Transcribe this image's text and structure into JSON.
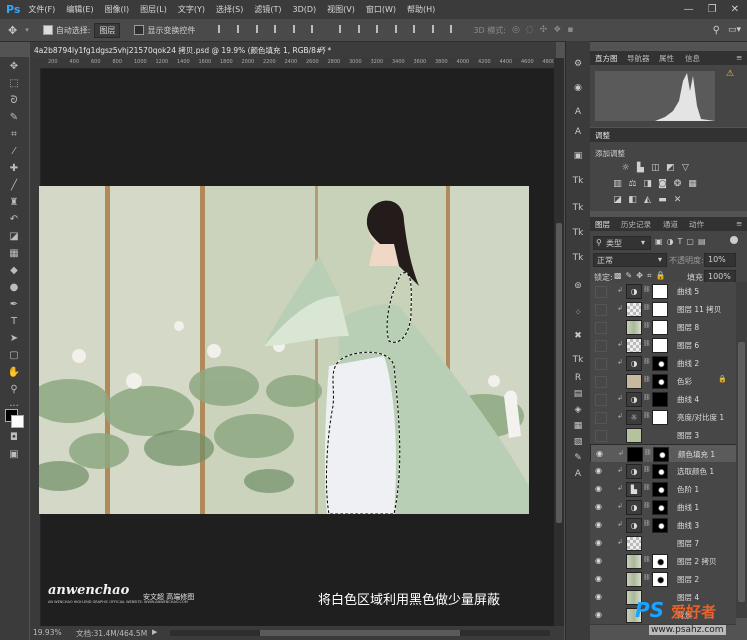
{
  "app": {
    "logo": "Ps"
  },
  "menu": [
    "文件(F)",
    "编辑(E)",
    "图像(I)",
    "图层(L)",
    "文字(Y)",
    "选择(S)",
    "滤镜(T)",
    "3D(D)",
    "视图(V)",
    "窗口(W)",
    "帮助(H)"
  ],
  "window_controls": [
    "—",
    "❐",
    "✕"
  ],
  "options": {
    "auto_select_label": "自动选择:",
    "auto_select_value": "图层",
    "show_transform_label": "显示变换控件",
    "mode_3d_label": "3D 模式:"
  },
  "document": {
    "tab_title": "4a2b8794ly1fg1dgsz5vhj21570qok24 拷贝.psd @ 19.9% (颜色填充 1, RGB/8#) *",
    "zoom": "19.93%",
    "doc_size": "文档:31.4M/464.5M",
    "ruler_marks": [
      "200",
      "400",
      "600",
      "800",
      "1000",
      "1200",
      "1400",
      "1600",
      "1800",
      "2000",
      "2200",
      "2400",
      "2600",
      "2800",
      "3000",
      "3200",
      "3400",
      "3600",
      "3800",
      "4000",
      "4200",
      "4400",
      "4600",
      "4800"
    ]
  },
  "watermark": {
    "brand": "anwenchao",
    "cn_brand": "安文超 高端修图",
    "tagline": "AN WENCHAO HIGH-END GRAPHIC OFFICIAL WEBSITE: WWW.ANWENCHAO.COM"
  },
  "caption": "将白色区域利用黑色做少量屏蔽",
  "panels": {
    "histogram_tabs": [
      "直方图",
      "导航器",
      "属性",
      "信息"
    ],
    "adjustments_tab": "调整",
    "adjustments_subtitle": "添加调整",
    "layers_tabs": [
      "图层",
      "历史记录",
      "通道",
      "动作"
    ],
    "filter_kind": "类型",
    "blend_mode": "正常",
    "opacity_label": "不透明度:",
    "opacity_value": "10%",
    "lock_label": "锁定:",
    "fill_label": "填充:",
    "fill_value": "100%"
  },
  "layers": [
    {
      "name": "曲线 5",
      "visible": false,
      "clipped": true,
      "thumb": "curves",
      "mask": "white"
    },
    {
      "name": "图层 11 拷贝",
      "visible": false,
      "clipped": true,
      "thumb": "checker",
      "mask": "white"
    },
    {
      "name": "图层 8",
      "visible": false,
      "clipped": false,
      "thumb": "photo",
      "mask": "white"
    },
    {
      "name": "图层 6",
      "visible": false,
      "clipped": true,
      "thumb": "checker",
      "mask": "white"
    },
    {
      "name": "曲线 2",
      "visible": false,
      "clipped": true,
      "thumb": "curves",
      "mask": "black-figure"
    },
    {
      "name": "色彩",
      "visible": false,
      "clipped": false,
      "thumb": "tan",
      "mask": "black-figure",
      "locked": true
    },
    {
      "name": "曲线 4",
      "visible": false,
      "clipped": true,
      "thumb": "curves",
      "mask": "black"
    },
    {
      "name": "亮度/对比度 1",
      "visible": false,
      "clipped": true,
      "thumb": "brightness",
      "mask": "white"
    },
    {
      "name": "图层 3",
      "visible": false,
      "clipped": false,
      "thumb": "green",
      "mask": ""
    },
    {
      "name": "颜色填充 1",
      "visible": true,
      "clipped": true,
      "thumb": "black-fill",
      "mask": "black-figure",
      "selected": true
    },
    {
      "name": "选取颜色 1",
      "visible": true,
      "clipped": true,
      "thumb": "selective",
      "mask": "black-figure"
    },
    {
      "name": "色阶 1",
      "visible": true,
      "clipped": true,
      "thumb": "levels",
      "mask": "black-figure"
    },
    {
      "name": "曲线 1",
      "visible": true,
      "clipped": true,
      "thumb": "curves",
      "mask": "black-figure"
    },
    {
      "name": "曲线 3",
      "visible": true,
      "clipped": true,
      "thumb": "curves",
      "mask": "black-figure"
    },
    {
      "name": "图层 7",
      "visible": true,
      "clipped": true,
      "thumb": "checker",
      "mask": ""
    },
    {
      "name": "图层 2 拷贝",
      "visible": true,
      "clipped": false,
      "thumb": "photo",
      "mask": "white-figure"
    },
    {
      "name": "图层 2",
      "visible": true,
      "clipped": false,
      "thumb": "photo",
      "mask": "white-figure"
    },
    {
      "name": "图层 4",
      "visible": true,
      "clipped": false,
      "thumb": "photo",
      "mask": ""
    },
    {
      "name": "背景",
      "visible": true,
      "clipped": false,
      "thumb": "photo",
      "mask": ""
    }
  ],
  "site_watermark": {
    "logo": "PS",
    "text": "爱好者",
    "url": "www.psahz.com"
  },
  "colors": {
    "accent": "#31a8ff",
    "background": "#535353",
    "canvas": "#1f1f1f",
    "panel": "#454545"
  }
}
